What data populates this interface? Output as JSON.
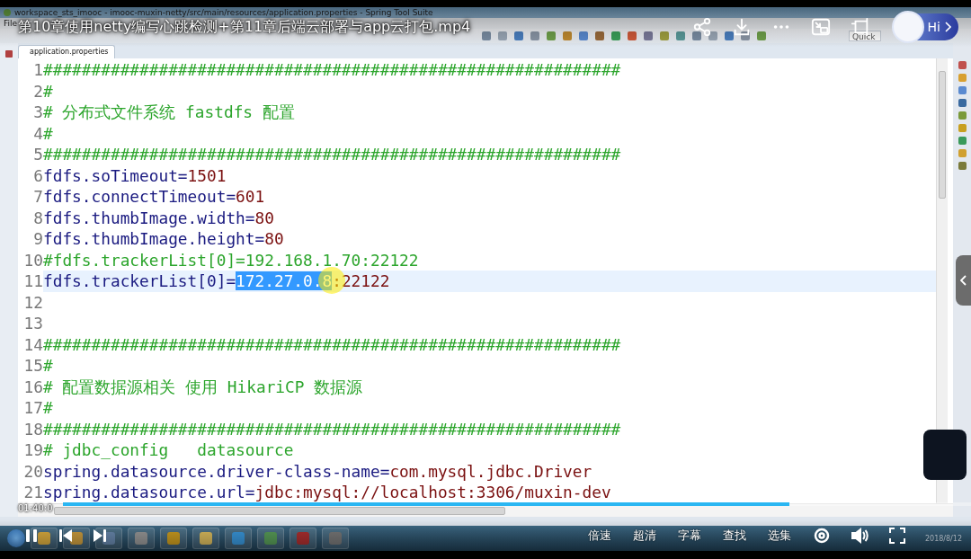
{
  "video": {
    "title": "第10章使用netty编写心跳检测+第11章后端云部署与app云打包.mp4",
    "time": "01:40:0",
    "progress": {
      "level": 0.8
    },
    "assistant": {
      "label": "Hi"
    },
    "controls": [
      "倍速",
      "超清",
      "字幕",
      "查找",
      "选集"
    ]
  },
  "ide": {
    "window_title": "workspace_sts_imooc - imooc-muxin-netty/src/main/resources/application.properties - Spring Tool Suite",
    "menu": [
      "File"
    ],
    "quick_access": "Quick",
    "editor_tab": "application.properties",
    "lines": [
      {
        "number": "1",
        "current": false,
        "tokens": [
          {
            "kind": "comment",
            "text": "############################################################"
          }
        ]
      },
      {
        "number": "2",
        "current": false,
        "tokens": [
          {
            "kind": "comment",
            "text": "#"
          }
        ]
      },
      {
        "number": "3",
        "current": false,
        "tokens": [
          {
            "kind": "comment",
            "text": "# 分布式文件系统 fastdfs 配置"
          }
        ]
      },
      {
        "number": "4",
        "current": false,
        "tokens": [
          {
            "kind": "comment",
            "text": "#"
          }
        ]
      },
      {
        "number": "5",
        "current": false,
        "tokens": [
          {
            "kind": "comment",
            "text": "############################################################"
          }
        ]
      },
      {
        "number": "6",
        "current": false,
        "tokens": [
          {
            "kind": "key",
            "text": "fdfs.soTimeout="
          },
          {
            "kind": "value",
            "text": "1501"
          }
        ]
      },
      {
        "number": "7",
        "current": false,
        "tokens": [
          {
            "kind": "key",
            "text": "fdfs.connectTimeout="
          },
          {
            "kind": "value",
            "text": "601"
          }
        ]
      },
      {
        "number": "8",
        "current": false,
        "tokens": [
          {
            "kind": "key",
            "text": "fdfs.thumbImage.width="
          },
          {
            "kind": "value",
            "text": "80"
          }
        ]
      },
      {
        "number": "9",
        "current": false,
        "tokens": [
          {
            "kind": "key",
            "text": "fdfs.thumbImage.height="
          },
          {
            "kind": "value",
            "text": "80"
          }
        ]
      },
      {
        "number": "10",
        "current": false,
        "tokens": [
          {
            "kind": "comment",
            "text": "#fdfs.trackerList[0]=192.168.1.70:22122"
          }
        ]
      },
      {
        "number": "11",
        "current": true,
        "tokens": [
          {
            "kind": "key",
            "text": "fdfs.trackerList[0]="
          },
          {
            "kind": "selected",
            "text": "172.27.0.8"
          },
          {
            "kind": "value",
            "text": ":22122"
          }
        ]
      },
      {
        "number": "12",
        "current": false
      },
      {
        "number": "13",
        "current": false
      },
      {
        "number": "14",
        "current": false,
        "tokens": [
          {
            "kind": "comment",
            "text": "############################################################"
          }
        ]
      },
      {
        "number": "15",
        "current": false,
        "tokens": [
          {
            "kind": "comment",
            "text": "#"
          }
        ]
      },
      {
        "number": "16",
        "current": false,
        "tokens": [
          {
            "kind": "comment",
            "text": "# 配置数据源相关 使用 HikariCP 数据源"
          }
        ]
      },
      {
        "number": "17",
        "current": false,
        "tokens": [
          {
            "kind": "comment",
            "text": "#"
          }
        ]
      },
      {
        "number": "18",
        "current": false,
        "tokens": [
          {
            "kind": "comment",
            "text": "############################################################"
          }
        ]
      },
      {
        "number": "19",
        "current": false,
        "tokens": [
          {
            "kind": "comment",
            "text": "# jdbc_config   datasource"
          }
        ]
      },
      {
        "number": "20",
        "current": false,
        "tokens": [
          {
            "kind": "key",
            "text": "spring.datasource.driver-class-name="
          },
          {
            "kind": "value",
            "text": "com.mysql.jdbc.Driver"
          }
        ]
      },
      {
        "number": "21",
        "current": false,
        "tokens": [
          {
            "kind": "key",
            "text": "spring.datasource.url="
          },
          {
            "kind": "value",
            "text": "jdbc:mysql://localhost:3306/muxin-dev"
          }
        ]
      }
    ]
  },
  "taskbar": {
    "date": "2018/8/12"
  }
}
